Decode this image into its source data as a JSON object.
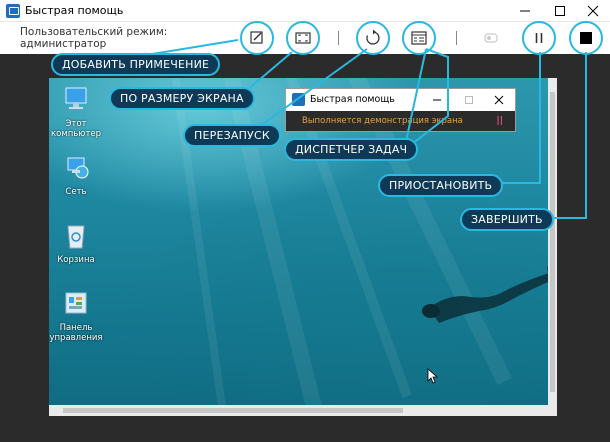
{
  "window": {
    "title": "Быстрая помощь"
  },
  "toolbar": {
    "mode_line1": "Пользовательский режим:",
    "mode_line2": "администратор",
    "icons": [
      "annotate-icon",
      "fit-screen-icon",
      "restart-icon",
      "task-manager-icon",
      "toggle-icon",
      "pause-icon",
      "stop-icon"
    ]
  },
  "callouts": {
    "annotate": "ДОБАВИТЬ ПРИМЕЧЕНИЕ",
    "fit": "ПО РАЗМЕРУ ЭКРАНА",
    "restart": "ПЕРЕЗАПУСК",
    "task_manager": "ДИСПЕТЧЕР ЗАДАЧ",
    "pause": "ПРИОСТАНОВИТЬ",
    "stop": "ЗАВЕРШИТЬ"
  },
  "remote_desktop": {
    "icons": [
      {
        "label_line1": "Этот",
        "label_line2": "компьютер"
      },
      {
        "label_line1": "Сеть",
        "label_line2": ""
      },
      {
        "label_line1": "Корзина",
        "label_line2": ""
      },
      {
        "label_line1": "Панель",
        "label_line2": "управления"
      }
    ],
    "inner_window": {
      "title": "Быстрая помощь",
      "status": "Выполняется демонстрация экрана",
      "pause_glyph": "||"
    }
  },
  "colors": {
    "accent": "#29b8e0",
    "callout_bg": "#0e3a57",
    "status_orange": "#e8a33c"
  }
}
